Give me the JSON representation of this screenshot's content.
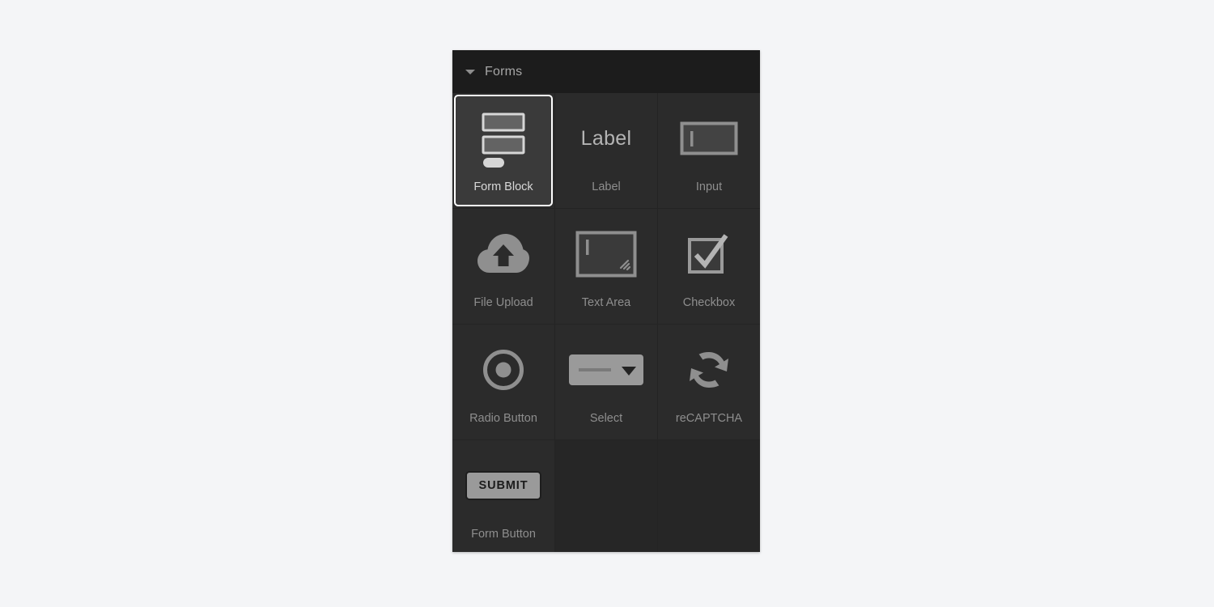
{
  "panel": {
    "header": {
      "title": "Forms",
      "disclosure_icon": "triangle-down-icon",
      "expanded": true
    },
    "colors": {
      "page_background": "#f4f5f7",
      "panel_background": "#2b2b2b",
      "header_background": "#1c1c1c",
      "selected_border": "#ffffff",
      "selected_tile_background": "#3a3a3a",
      "label_text": "#8e8e8e",
      "selected_label_text": "#d8d8d8",
      "icon_gray": "#8f8f8f"
    },
    "grid": {
      "columns": 3,
      "rows": 4,
      "items": [
        {
          "label": "Form Block",
          "icon": "form-block-icon",
          "selected": true
        },
        {
          "label": "Label",
          "icon": "label-text-icon",
          "selected": false
        },
        {
          "label": "Input",
          "icon": "input-field-icon",
          "selected": false
        },
        {
          "label": "File Upload",
          "icon": "cloud-upload-icon",
          "selected": false
        },
        {
          "label": "Text Area",
          "icon": "text-area-icon",
          "selected": false
        },
        {
          "label": "Checkbox",
          "icon": "checkbox-icon",
          "selected": false
        },
        {
          "label": "Radio Button",
          "icon": "radio-button-icon",
          "selected": false
        },
        {
          "label": "Select",
          "icon": "select-dropdown-icon",
          "selected": false
        },
        {
          "label": "reCAPTCHA",
          "icon": "recaptcha-refresh-icon",
          "selected": false
        },
        {
          "label": "Form Button",
          "icon": "submit-button-icon",
          "selected": false
        }
      ],
      "empty_cells": 2
    },
    "form_button": {
      "button_text": "SUBMIT"
    }
  }
}
